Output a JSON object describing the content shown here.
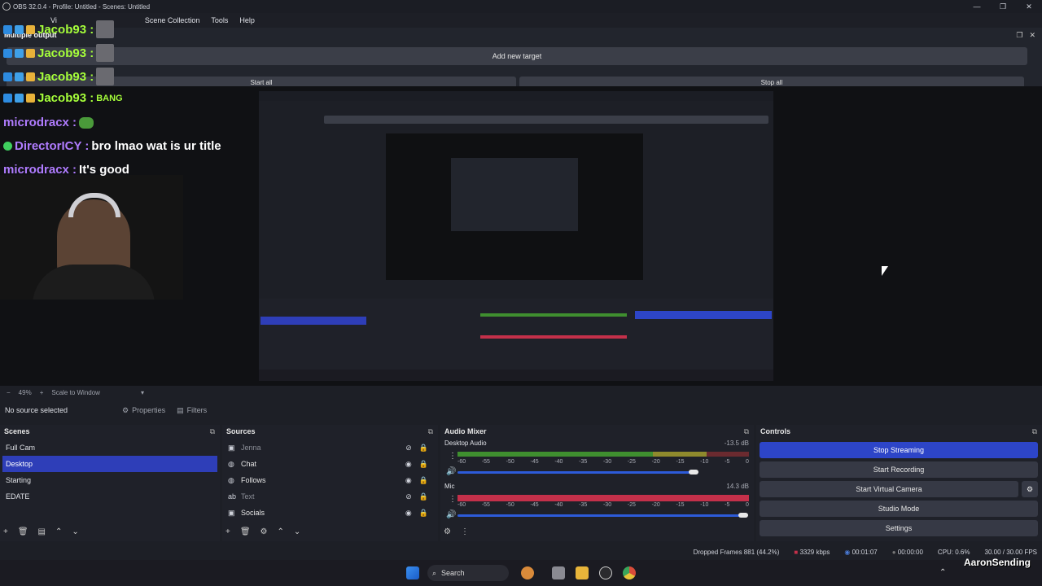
{
  "window": {
    "title": "OBS 32.0.4 - Profile: Untitled - Scenes: Untitled",
    "controls": [
      "—",
      "❐",
      "✕"
    ]
  },
  "menu": [
    "Vi",
    "Scene Collection",
    "Tools",
    "Help"
  ],
  "multiple_output": {
    "title": "Multiple output",
    "add_target": "Add new target",
    "start_all": "Start all",
    "stop_all": "Stop all"
  },
  "chat": [
    {
      "user": "Jacob93",
      "msg": "",
      "color": "#a6ff3a"
    },
    {
      "user": "Jacob93",
      "msg": "",
      "color": "#a6ff3a"
    },
    {
      "user": "Jacob93",
      "msg": "",
      "color": "#a6ff3a"
    },
    {
      "user": "Jacob93",
      "msg": "BANG",
      "color": "#a6ff3a"
    },
    {
      "user": "microdracx",
      "msg": "",
      "color": "#b07cff"
    },
    {
      "user": "DirectorICY",
      "msg": "bro lmao wat is ur title",
      "color": "#b07cff"
    },
    {
      "user": "microdracx",
      "msg": "It's good",
      "color": "#b07cff"
    }
  ],
  "zoom": {
    "value": "49%",
    "mode": "Scale to Window"
  },
  "source_toolbar": {
    "status": "No source selected",
    "properties": "Properties",
    "filters": "Filters"
  },
  "scenes": {
    "title": "Scenes",
    "items": [
      "Full Cam",
      "Desktop",
      "Starting",
      "EDATE"
    ],
    "selected": 1
  },
  "sources": {
    "title": "Sources",
    "items": [
      {
        "name": "Jenna",
        "icon": "image-icon",
        "visible": false
      },
      {
        "name": "Chat",
        "icon": "browser-icon",
        "visible": true
      },
      {
        "name": "Follows",
        "icon": "browser-icon",
        "visible": true
      },
      {
        "name": "Text",
        "icon": "text-icon",
        "visible": false
      },
      {
        "name": "Socials",
        "icon": "image-icon",
        "visible": true
      }
    ]
  },
  "mixer": {
    "title": "Audio Mixer",
    "channels": [
      {
        "name": "Desktop Audio",
        "db": "-13.5 dB",
        "fader": 0.81
      },
      {
        "name": "Mic",
        "db": "14.3 dB",
        "fader": 0.98
      }
    ],
    "scale": [
      "-60",
      "-55",
      "-50",
      "-45",
      "-40",
      "-35",
      "-30",
      "-25",
      "-20",
      "-15",
      "-10",
      "-5",
      "0"
    ]
  },
  "controls": {
    "title": "Controls",
    "stop_streaming": "Stop Streaming",
    "start_recording": "Start Recording",
    "start_virtual_camera": "Start Virtual Camera",
    "studio_mode": "Studio Mode",
    "settings": "Settings"
  },
  "status": {
    "dropped_frames": "Dropped Frames 881 (44.2%)",
    "bitrate": "3329 kbps",
    "stream_time": "00:01:07",
    "rec_time": "00:00:00",
    "cpu": "CPU: 0.6%",
    "fps": "30.00 / 30.00 FPS"
  },
  "taskbar": {
    "search": "Search",
    "brand": "AaronSending"
  },
  "colors": {
    "accent": "#2e3eb8",
    "stream_button": "#2d45c8",
    "meter_green": "#3f8f2f",
    "meter_yellow": "#8f8a2d",
    "meter_red": "#c4304a"
  }
}
